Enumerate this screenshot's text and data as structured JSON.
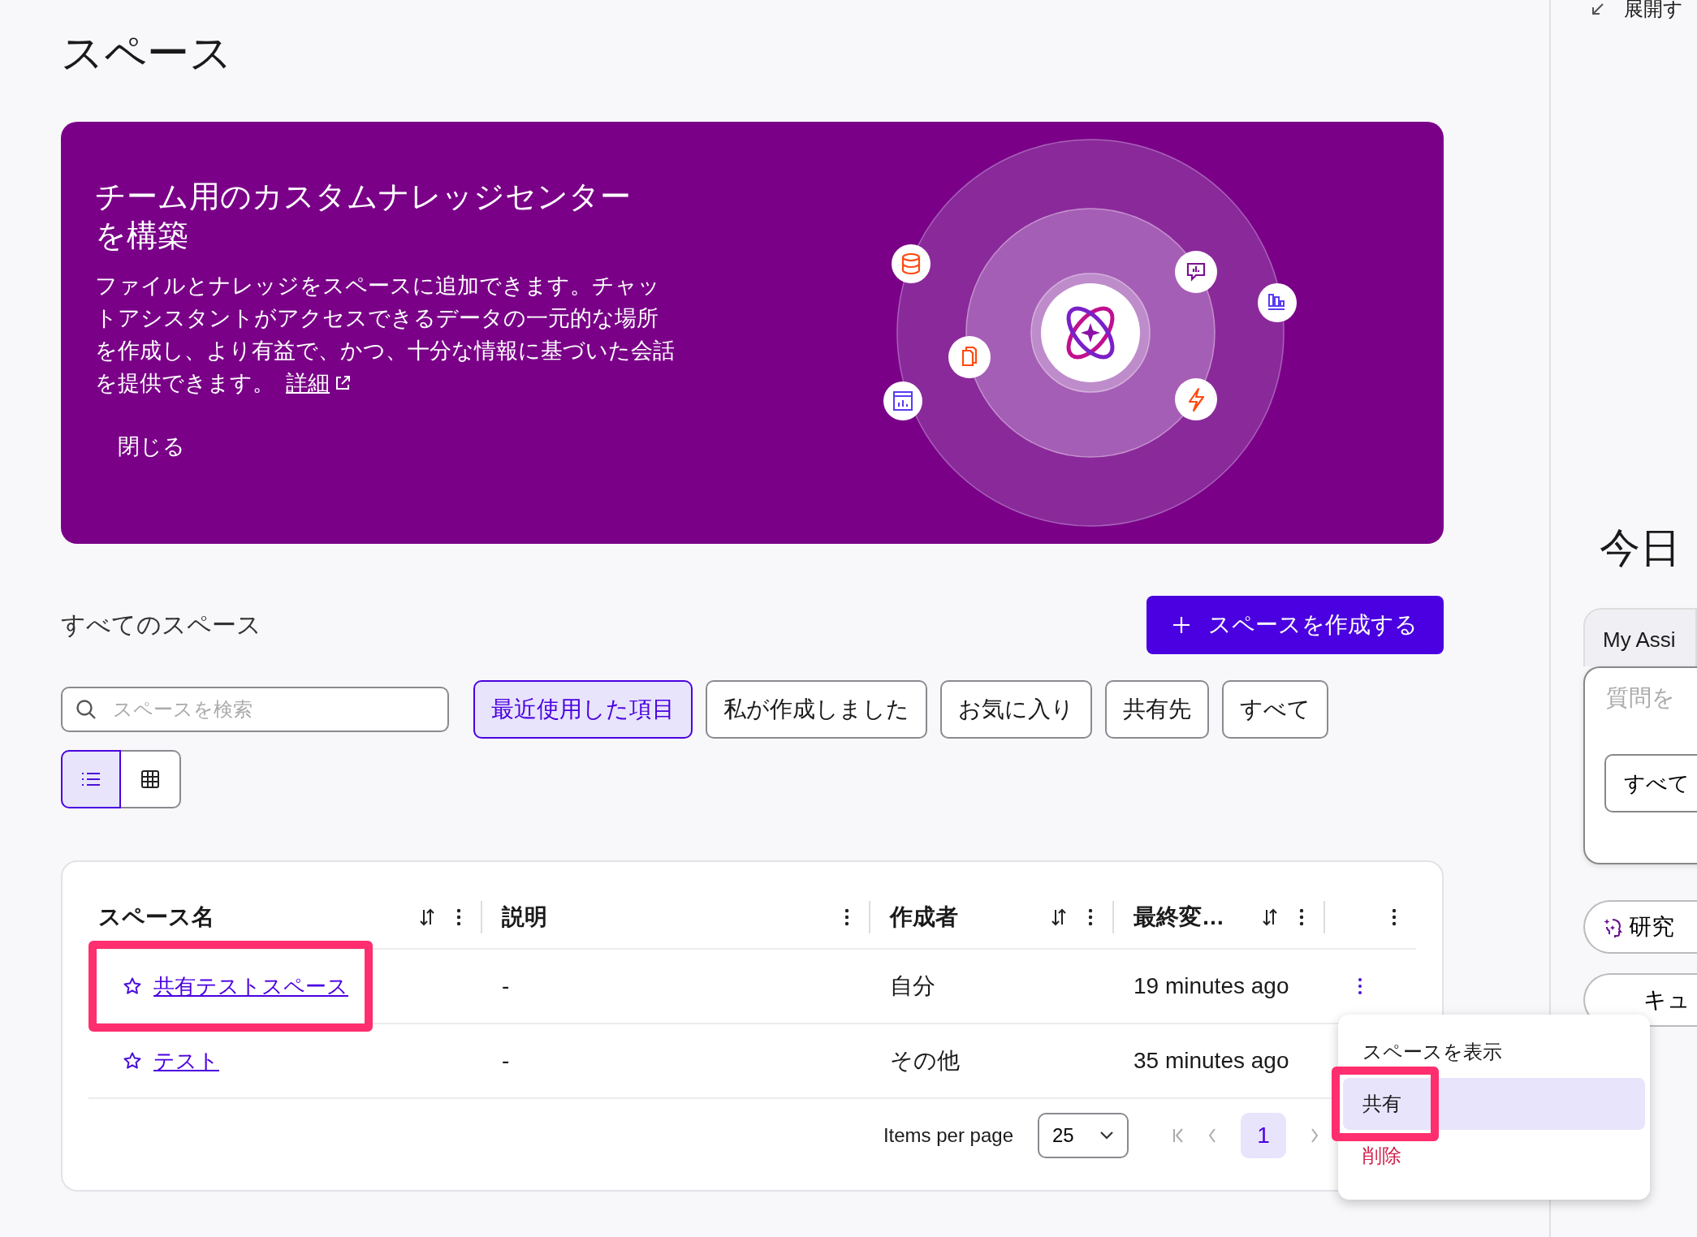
{
  "page_title": "スペース",
  "banner": {
    "title": "チーム用のカスタムナレッジセンターを構築",
    "description": "ファイルとナレッジをスペースに追加できます。チャットアシスタントがアクセスできるデータの一元的な場所を作成し、より有益で、かつ、十分な情報に基づいた会話を提供できます。",
    "link": "詳細",
    "close": "閉じる"
  },
  "section_title": "すべてのスペース",
  "create_button": "スペースを作成する",
  "search": {
    "placeholder": "スペースを検索"
  },
  "filters": [
    {
      "label": "最近使用した項目",
      "selected": true
    },
    {
      "label": "私が作成しました",
      "selected": false
    },
    {
      "label": "お気に入り",
      "selected": false
    },
    {
      "label": "共有先",
      "selected": false
    },
    {
      "label": "すべて",
      "selected": false
    }
  ],
  "view_toggle": [
    {
      "kind": "list",
      "selected": true
    },
    {
      "kind": "grid",
      "selected": false
    }
  ],
  "table": {
    "columns": [
      {
        "label": "スペース名",
        "sortable": true
      },
      {
        "label": "説明",
        "sortable": false
      },
      {
        "label": "作成者",
        "sortable": true
      },
      {
        "label": "最終変…",
        "sortable": true
      }
    ],
    "rows": [
      {
        "name": "共有テストスペース",
        "description": "-",
        "creator": "自分",
        "modified": "19 minutes ago",
        "favorite": false,
        "highlighted": true,
        "menu_open": true
      },
      {
        "name": "テスト",
        "description": "-",
        "creator": "その他",
        "modified": "35 minutes ago",
        "favorite": false,
        "highlighted": false,
        "menu_open": false
      }
    ]
  },
  "pagination": {
    "label": "Items per page",
    "page_size": "25",
    "pages": [
      {
        "label": "1",
        "selected": true
      }
    ]
  },
  "context_menu": [
    {
      "label": "スペースを表示",
      "kind": "normal",
      "selected": false,
      "highlighted": false
    },
    {
      "label": "共有",
      "kind": "normal",
      "selected": true,
      "highlighted": true
    },
    {
      "label": "削除",
      "kind": "danger",
      "selected": false,
      "highlighted": false
    }
  ],
  "right_panel": {
    "collapse_label": "展開す",
    "heading": "今日",
    "tab": "My Assi",
    "input_placeholder": "質問を",
    "scope_button": "すべて",
    "chips": [
      {
        "label": "研究",
        "kind": "research"
      },
      {
        "label": "キュ",
        "kind": "document"
      }
    ]
  }
}
